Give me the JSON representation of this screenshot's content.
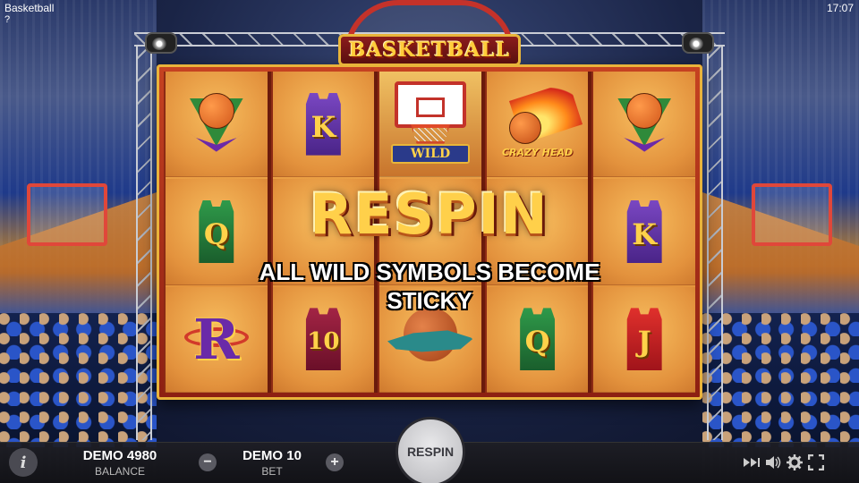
{
  "app": {
    "title": "Basketball",
    "help": "?",
    "clock": "17:07"
  },
  "logo": {
    "text": "BASKETBALL"
  },
  "reels": [
    [
      "shield-ball",
      "jersey-q",
      "r-symbol"
    ],
    [
      "jersey-k",
      "jersey-empty",
      "jersey-10"
    ],
    [
      "wild",
      "blank",
      "dog"
    ],
    [
      "crazy-head",
      "blank",
      "jersey-q"
    ],
    [
      "shield-ball",
      "jersey-k",
      "jersey-j"
    ]
  ],
  "symbols": {
    "k": "K",
    "q": "Q",
    "j": "J",
    "num10": "10",
    "r": "R",
    "wild": "WILD",
    "crazy": "CRAZY HEAD"
  },
  "overlay": {
    "title": "RESPIN",
    "line1": "ALL WILD SYMBOLS BECOME",
    "line2": "STICKY"
  },
  "bottom": {
    "info": "i",
    "balance_value": "DEMO 4980",
    "balance_label": "BALANCE",
    "bet_value": "DEMO 10",
    "bet_label": "BET",
    "minus": "−",
    "plus": "+",
    "spin_label": "RESPIN"
  },
  "colors": {
    "accent": "#ffd04a",
    "frame": "#c64221"
  }
}
